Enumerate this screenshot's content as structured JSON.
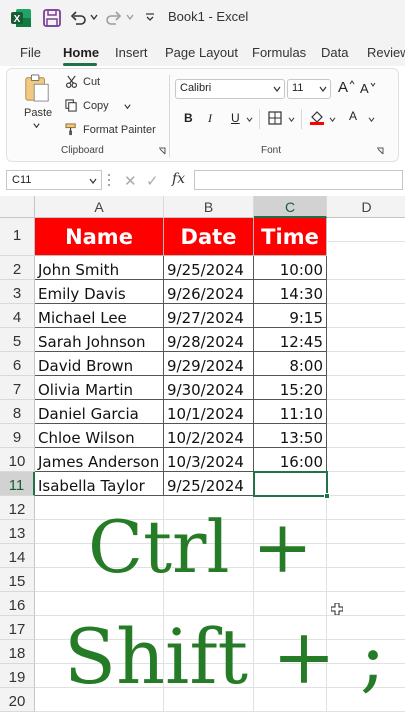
{
  "titlebar": {
    "doc_title": "Book1  -  Excel",
    "icons": [
      "excel-logo-icon",
      "save-icon",
      "undo-icon",
      "redo-icon",
      "customize-qat-icon"
    ]
  },
  "ribbon_tabs": [
    "File",
    "Home",
    "Insert",
    "Page Layout",
    "Formulas",
    "Data",
    "Review"
  ],
  "active_tab": "Home",
  "ribbon": {
    "clipboard": {
      "paste": "Paste",
      "cut": "Cut",
      "copy": "Copy",
      "format_painter": "Format Painter",
      "group_label": "Clipboard"
    },
    "font": {
      "font_name": "Calibri",
      "font_size": "11",
      "bold": "B",
      "italic": "I",
      "underline": "U",
      "grow": "A",
      "shrink": "A",
      "font_color_letter": "A",
      "group_label": "Font"
    }
  },
  "formula_bar": {
    "name_box": "C11",
    "cancel": "✕",
    "enter": "✓",
    "fx": "fx",
    "formula": ""
  },
  "sheet": {
    "columns": [
      "A",
      "B",
      "C",
      "D"
    ],
    "rows": [
      "1",
      "2",
      "3",
      "4",
      "5",
      "6",
      "7",
      "8",
      "9",
      "10",
      "11",
      "12",
      "13",
      "14",
      "15",
      "16",
      "17",
      "18",
      "19",
      "20"
    ],
    "header": {
      "name": "Name",
      "date": "Date",
      "time": "Time"
    },
    "records": [
      {
        "name": "John Smith",
        "date": "9/25/2024",
        "time": "10:00"
      },
      {
        "name": "Emily Davis",
        "date": "9/26/2024",
        "time": "14:30"
      },
      {
        "name": "Michael Lee",
        "date": "9/27/2024",
        "time": "9:15"
      },
      {
        "name": "Sarah Johnson",
        "date": "9/28/2024",
        "time": "12:45"
      },
      {
        "name": "David Brown",
        "date": "9/29/2024",
        "time": "8:00"
      },
      {
        "name": "Olivia Martin",
        "date": "9/30/2024",
        "time": "15:20"
      },
      {
        "name": "Daniel Garcia",
        "date": "10/1/2024",
        "time": "11:10"
      },
      {
        "name": "Chloe Wilson",
        "date": "10/2/2024",
        "time": "13:50"
      },
      {
        "name": "James Anderson",
        "date": "10/3/2024",
        "time": "16:00"
      },
      {
        "name": "Isabella Taylor",
        "date": "9/25/2024",
        "time": ""
      }
    ],
    "header_fill": "#ff0000",
    "selection_color": "#217346"
  },
  "overlay": {
    "line1": "Ctrl +",
    "line2": "Shift + ;",
    "color": "#267b26"
  }
}
